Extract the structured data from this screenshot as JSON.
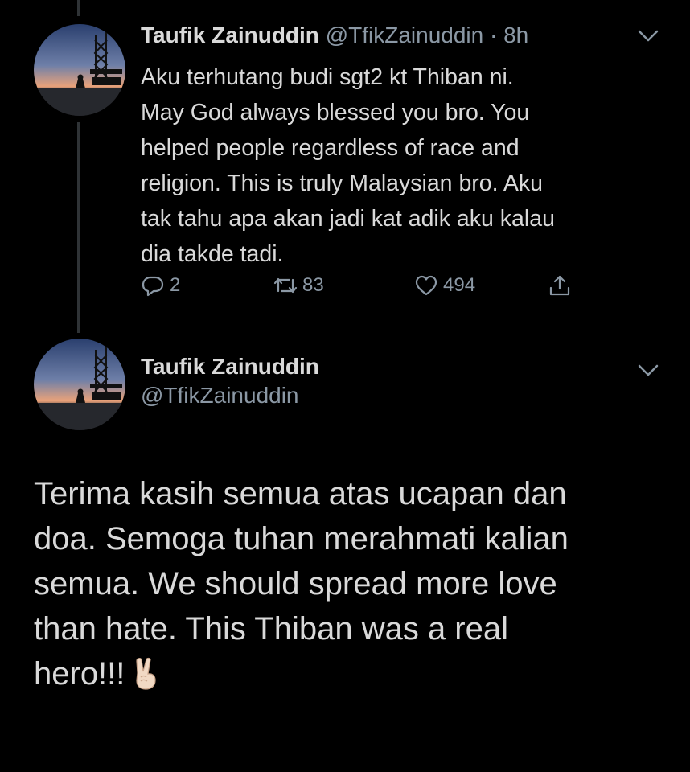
{
  "tweet1": {
    "name": "Taufik Zainuddin",
    "handle": "@TfikZainuddin",
    "time": "· 8h",
    "text": "Aku terhutang budi sgt2 kt Thiban ni.\nMay God always blessed you bro. You\nhelped people regardless of race and\nreligion. This is truly Malaysian bro. Aku\ntak tahu apa akan jadi kat adik aku kalau\ndia takde tadi.",
    "replies": "2",
    "retweets": "83",
    "likes": "494"
  },
  "tweet2": {
    "name": "Taufik Zainuddin",
    "handle": "@TfikZainuddin",
    "text": "Terima kasih semua atas ucapan dan\ndoa. Semoga tuhan merahmati kalian\nsemua. We should spread more love\nthan hate. This Thiban was a real\nhero!!!",
    "emoji": "victory-hand"
  },
  "icons": {
    "reply": "reply-icon",
    "retweet": "retweet-icon",
    "like": "heart-icon",
    "share": "share-icon",
    "chevron": "chevron-down-icon"
  },
  "colors": {
    "background": "#000000",
    "primary_text": "#d9d9d9",
    "secondary_text": "#8b98a5",
    "thread_line": "#2f3336"
  }
}
